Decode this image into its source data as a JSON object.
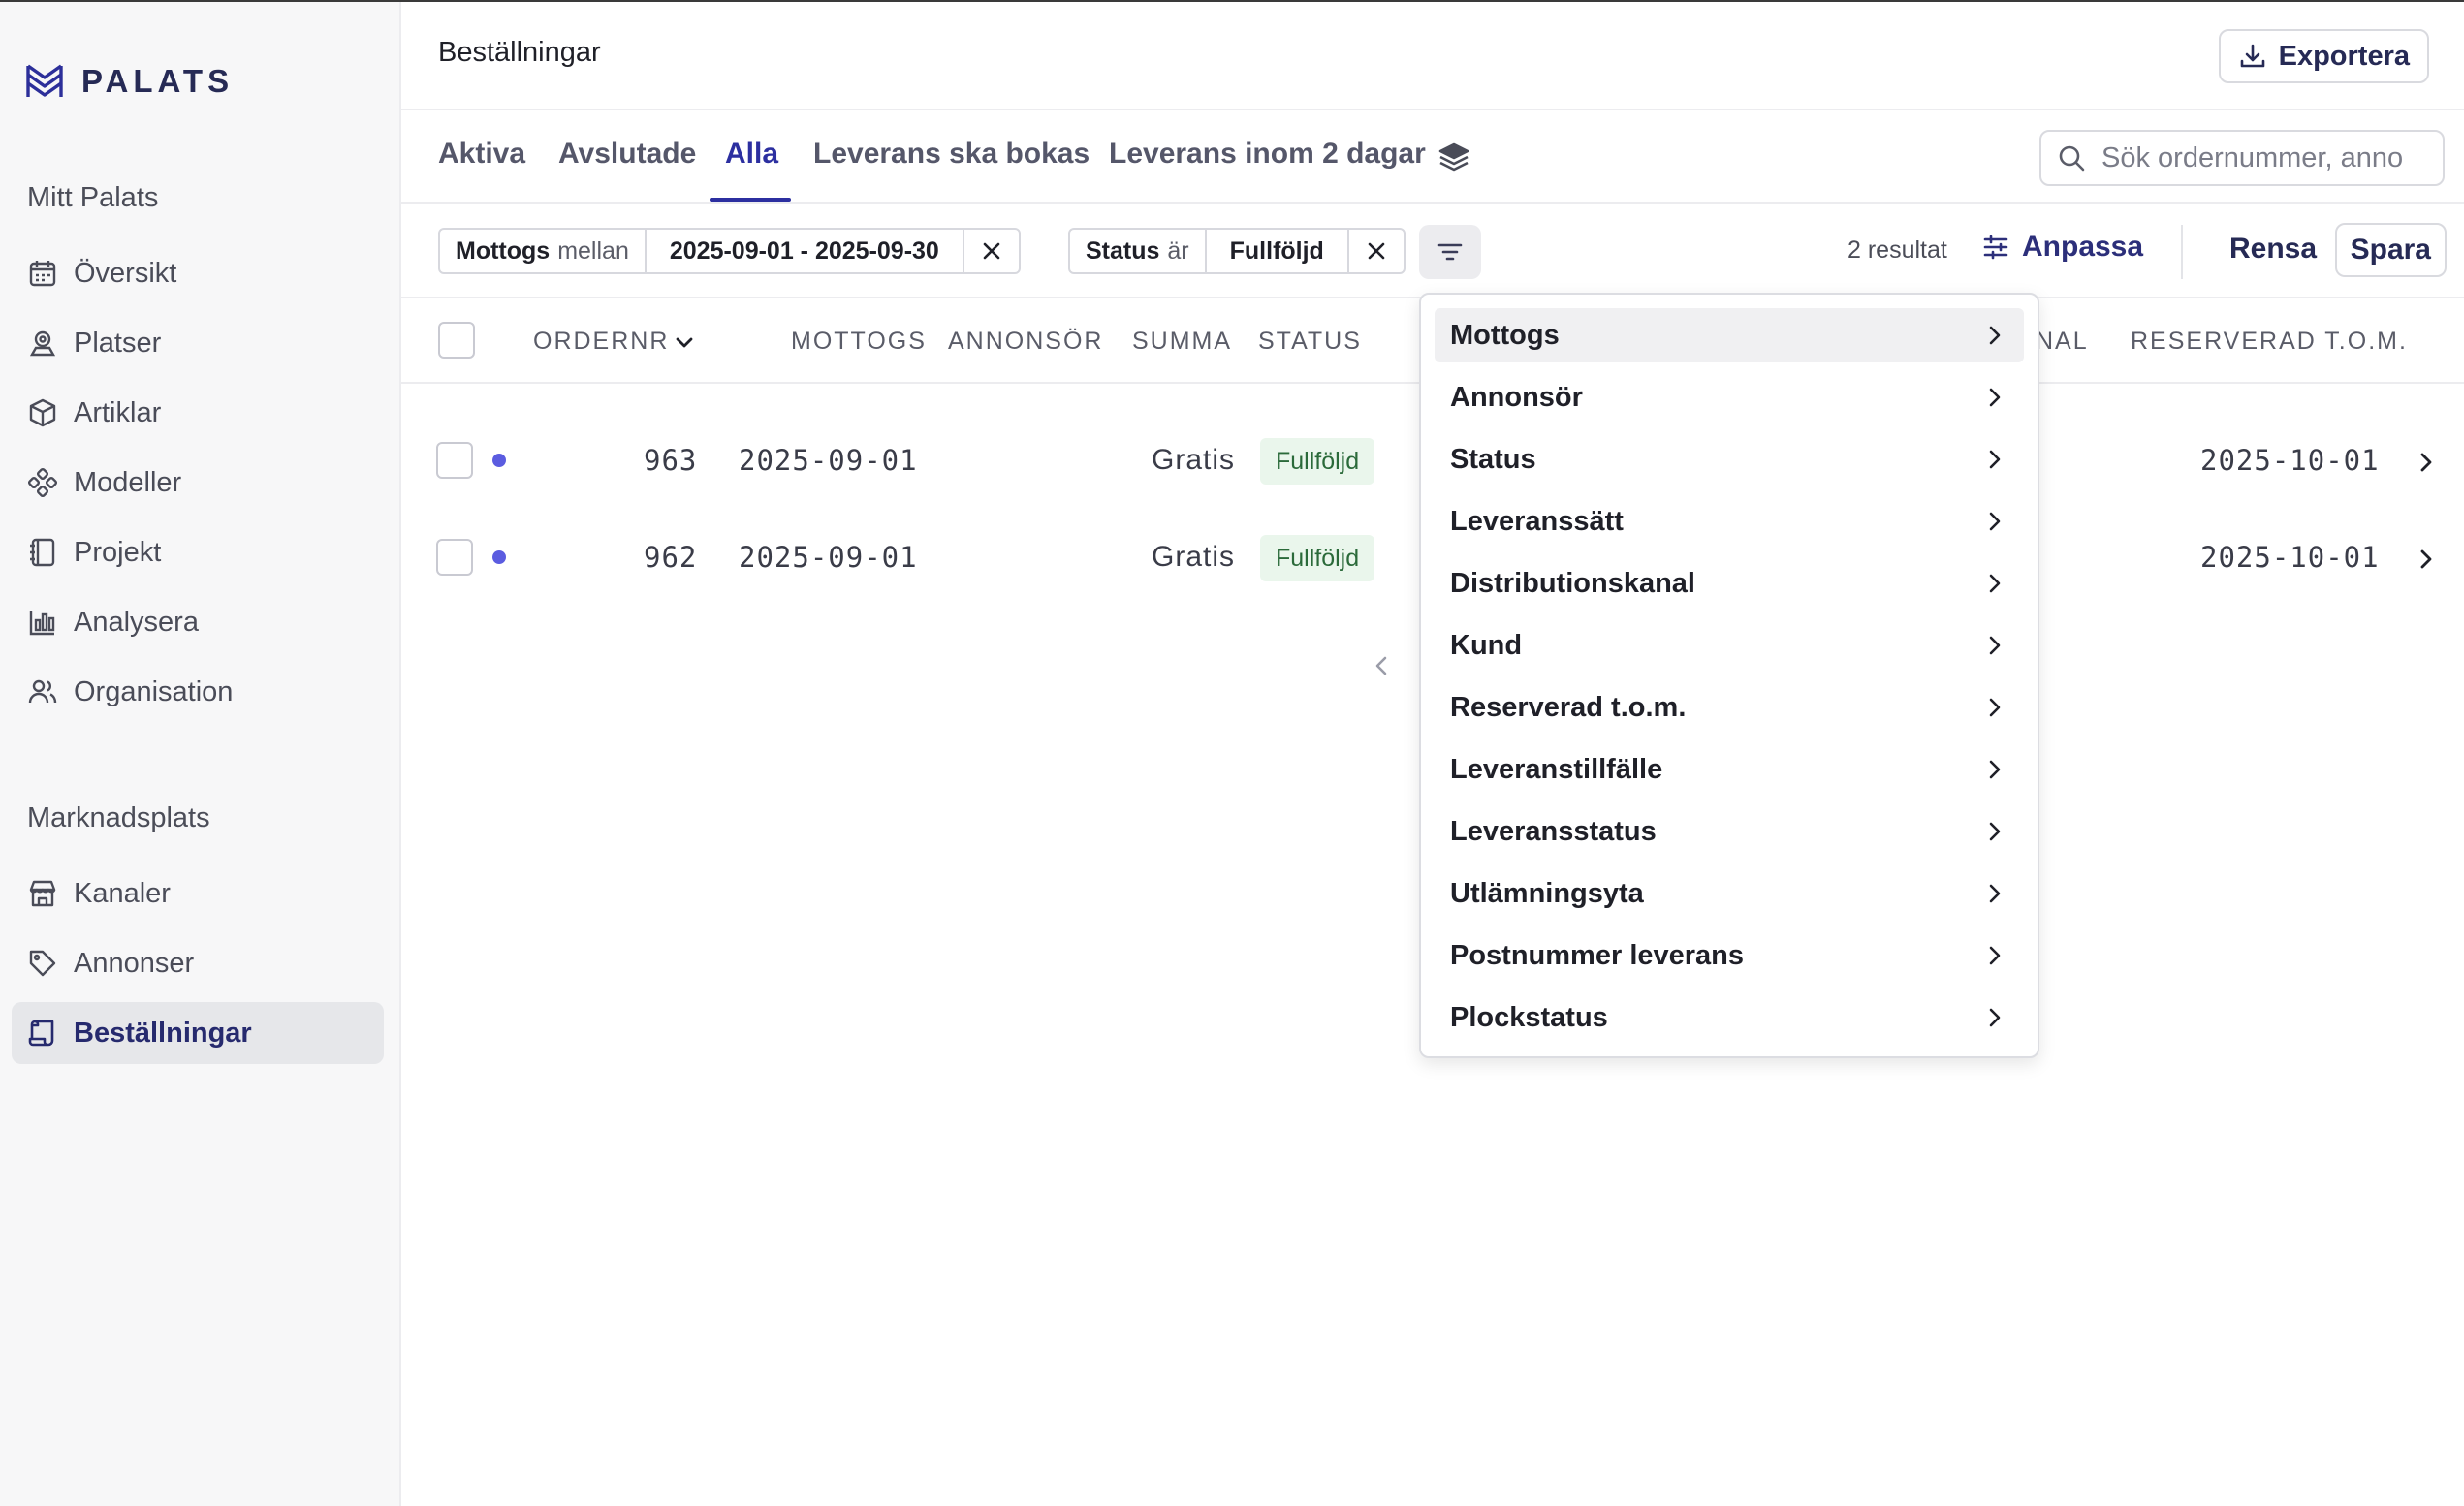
{
  "app": {
    "logo_text": "PALATS"
  },
  "sidebar": {
    "section1_title": "Mitt Palats",
    "section1_items": [
      {
        "label": "Översikt",
        "icon": "calendar-icon"
      },
      {
        "label": "Platser",
        "icon": "map-pin-icon"
      },
      {
        "label": "Artiklar",
        "icon": "box-icon"
      },
      {
        "label": "Modeller",
        "icon": "components-icon"
      },
      {
        "label": "Projekt",
        "icon": "notebook-icon"
      },
      {
        "label": "Analysera",
        "icon": "bar-chart-icon"
      },
      {
        "label": "Organisation",
        "icon": "users-icon"
      }
    ],
    "section2_title": "Marknadsplats",
    "section2_items": [
      {
        "label": "Kanaler",
        "icon": "store-icon"
      },
      {
        "label": "Annonser",
        "icon": "tag-icon"
      },
      {
        "label": "Beställningar",
        "icon": "scroll-icon",
        "active": true
      }
    ]
  },
  "header": {
    "title": "Beställningar",
    "export_label": "Exportera"
  },
  "tabs": [
    {
      "label": "Aktiva"
    },
    {
      "label": "Avslutade"
    },
    {
      "label": "Alla",
      "active": true
    },
    {
      "label": "Leverans ska bokas"
    },
    {
      "label": "Leverans inom 2 dagar"
    }
  ],
  "search": {
    "placeholder": "Sök ordernummer, anno",
    "value": ""
  },
  "filters": {
    "chip1": {
      "key": "Mottogs",
      "op": "mellan",
      "value": "2025-09-01 - 2025-09-30"
    },
    "chip2": {
      "key": "Status",
      "op": "är",
      "value": "Fullföljd"
    },
    "results": "2 resultat",
    "customize_label": "Anpassa",
    "clear_label": "Rensa",
    "save_label": "Spara"
  },
  "table": {
    "columns": {
      "ordernr": "Ordernr",
      "mottogs": "Mottogs",
      "annonsor": "Annonsör",
      "summa": "Summa",
      "status": "Status",
      "kanal_partial": "nal",
      "reserverad": "Reserverad t.o.m."
    },
    "rows": [
      {
        "ordernr": "963",
        "mottogs": "2025-09-01",
        "summa": "Gratis",
        "status": "Fullföljd",
        "reserverad": "2025-10-01"
      },
      {
        "ordernr": "962",
        "mottogs": "2025-09-01",
        "summa": "Gratis",
        "status": "Fullföljd",
        "reserverad": "2025-10-01"
      }
    ]
  },
  "filter_menu": {
    "items": [
      "Mottogs",
      "Annonsör",
      "Status",
      "Leveranssätt",
      "Distributionskanal",
      "Kund",
      "Reserverad t.o.m.",
      "Leveranstillfälle",
      "Leveransstatus",
      "Utlämningsyta",
      "Postnummer leverans",
      "Plockstatus"
    ],
    "highlighted": "Mottogs"
  },
  "colors": {
    "accent": "#2c2fa0",
    "badge_bg": "#eaf6ec",
    "badge_text": "#2b6a3a",
    "dot": "#5b5ce0"
  }
}
